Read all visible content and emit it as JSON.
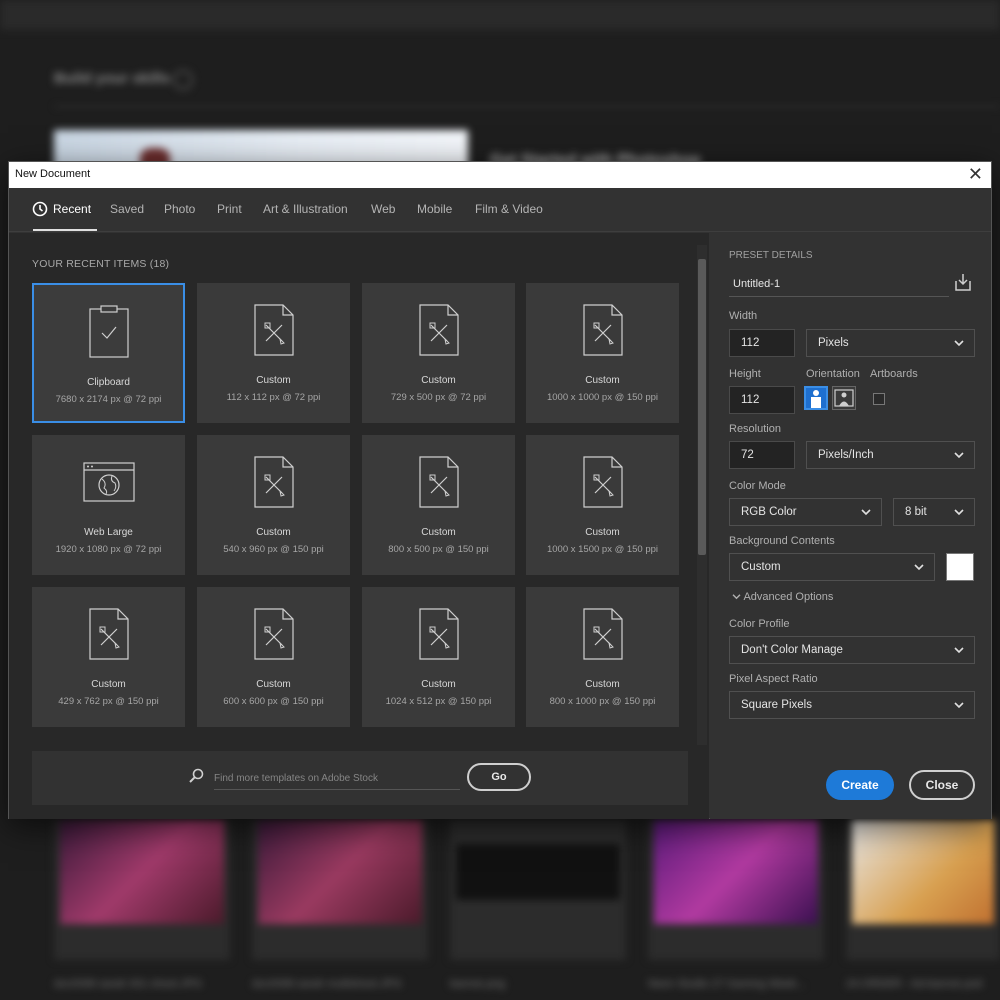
{
  "background": {
    "heading": "Build your skills",
    "hero_title": "Get Started with Photoshop",
    "thumbs": [
      {
        "caption": "dzc0098 sarah 001 shoot.JPG"
      },
      {
        "caption": "dzc0098 sarah multishoot.JPG"
      },
      {
        "caption": "banner.png"
      },
      {
        "caption": "Neon Studio 27 Gaming Week..."
      },
      {
        "caption": "24-ORDER - Ad-banner.psd"
      }
    ]
  },
  "dialog": {
    "title": "New Document",
    "close_glyph": "✕"
  },
  "tabs": [
    "Recent",
    "Saved",
    "Photo",
    "Print",
    "Art & Illustration",
    "Web",
    "Mobile",
    "Film & Video"
  ],
  "recent": {
    "header": "YOUR RECENT ITEMS",
    "count": "(18)",
    "items": [
      {
        "name": "Clipboard",
        "meta": "7680 x 2174 px @ 72 ppi",
        "icon": "clipboard-icon"
      },
      {
        "name": "Custom",
        "meta": "112 x 112 px @ 72 ppi",
        "icon": "custom-doc-icon"
      },
      {
        "name": "Custom",
        "meta": "729 x 500 px @ 72 ppi",
        "icon": "custom-doc-icon"
      },
      {
        "name": "Custom",
        "meta": "1000 x 1000 px @ 150 ppi",
        "icon": "custom-doc-icon"
      },
      {
        "name": "Web Large",
        "meta": "1920 x 1080 px @ 72 ppi",
        "icon": "web-icon"
      },
      {
        "name": "Custom",
        "meta": "540 x 960 px @ 150 ppi",
        "icon": "custom-doc-icon"
      },
      {
        "name": "Custom",
        "meta": "800 x 500 px @ 150 ppi",
        "icon": "custom-doc-icon"
      },
      {
        "name": "Custom",
        "meta": "1000 x 1500 px @ 150 ppi",
        "icon": "custom-doc-icon"
      },
      {
        "name": "Custom",
        "meta": "429 x 762 px @ 150 ppi",
        "icon": "custom-doc-icon"
      },
      {
        "name": "Custom",
        "meta": "600 x 600 px @ 150 ppi",
        "icon": "custom-doc-icon"
      },
      {
        "name": "Custom",
        "meta": "1024 x 512 px @ 150 ppi",
        "icon": "custom-doc-icon"
      },
      {
        "name": "Custom",
        "meta": "800 x 1000 px @ 150 ppi",
        "icon": "custom-doc-icon"
      }
    ]
  },
  "search": {
    "placeholder": "Find more templates on Adobe Stock",
    "go_label": "Go"
  },
  "preset": {
    "title": "PRESET DETAILS",
    "name": "Untitled-1",
    "width_label": "Width",
    "width_value": "112",
    "width_unit": "Pixels",
    "height_label": "Height",
    "height_value": "112",
    "orientation_label": "Orientation",
    "artboards_label": "Artboards",
    "resolution_label": "Resolution",
    "resolution_value": "72",
    "resolution_unit": "Pixels/Inch",
    "color_mode_label": "Color Mode",
    "color_mode": "RGB Color",
    "bit_depth": "8 bit",
    "background_label": "Background Contents",
    "background": "Custom",
    "background_color": "#ffffff",
    "advanced_label": "Advanced Options",
    "color_profile_label": "Color Profile",
    "color_profile": "Don't Color Manage",
    "pixel_aspect_label": "Pixel Aspect Ratio",
    "pixel_aspect": "Square Pixels",
    "create_label": "Create",
    "close_label": "Close"
  },
  "colors": {
    "accent": "#1e7ad8",
    "selection": "#3a8ee6",
    "dialog_bg": "#323232",
    "panel_bg": "#282828",
    "card_bg": "#3a3a3a"
  }
}
